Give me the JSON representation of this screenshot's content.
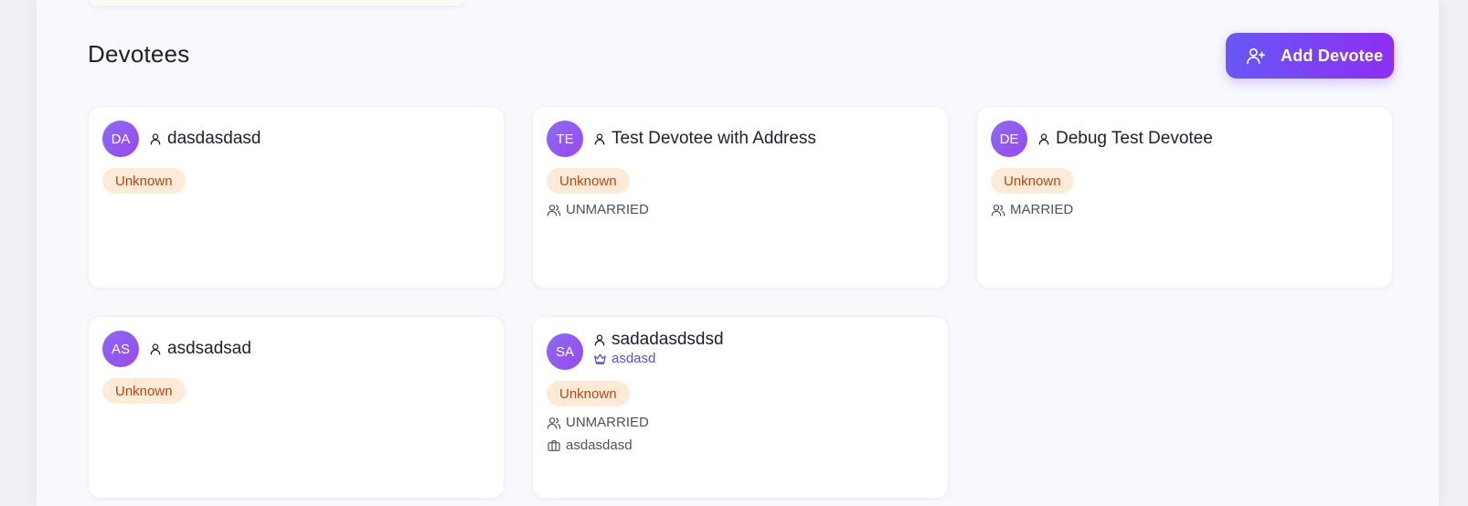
{
  "page": {
    "title": "Devotees",
    "add_button_label": "Add Devotee"
  },
  "colors": {
    "accent_start": "#6757f5",
    "accent_end": "#8f2ff0",
    "badge_bg": "#fdebd8",
    "badge_text": "#b34712",
    "gotra_text": "#5b4be0"
  },
  "devotees": [
    {
      "initials": "DA",
      "name": "dasdasdasd",
      "status": "Unknown"
    },
    {
      "initials": "TE",
      "name": "Test Devotee with Address",
      "status": "Unknown",
      "marital_status": "UNMARRIED"
    },
    {
      "initials": "DE",
      "name": "Debug Test Devotee",
      "status": "Unknown",
      "marital_status": "MARRIED"
    },
    {
      "initials": "AS",
      "name": "asdsadsad",
      "status": "Unknown"
    },
    {
      "initials": "SA",
      "name": "sadadasdsdsd",
      "gotra": "asdasd",
      "status": "Unknown",
      "marital_status": "UNMARRIED",
      "occupation": "asdasdasd"
    }
  ],
  "icons": {
    "add_button": "user-plus-icon",
    "name": "user-icon",
    "gotra": "crown-icon",
    "marital": "users-icon",
    "occupation": "briefcase-icon"
  }
}
